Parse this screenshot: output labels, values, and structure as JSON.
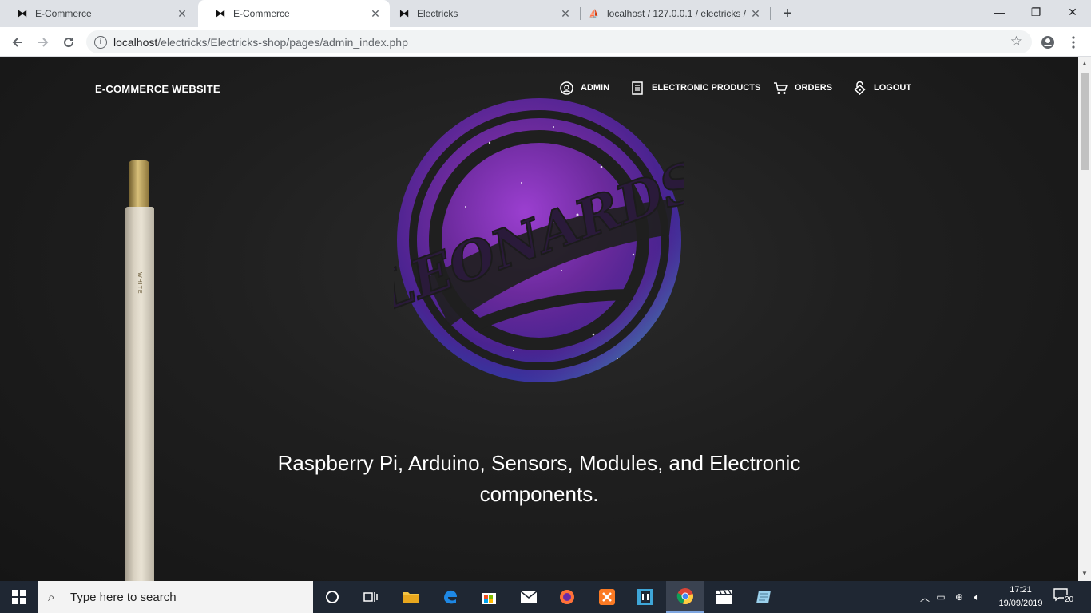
{
  "browser": {
    "tabs": [
      {
        "title": "E-Commerce",
        "active": false
      },
      {
        "title": "E-Commerce",
        "active": true
      },
      {
        "title": "Electricks",
        "active": false
      },
      {
        "title": "localhost / 127.0.0.1 / electricks /",
        "active": false
      }
    ],
    "url_host": "localhost",
    "url_path": "/electricks/Electricks-shop/pages/admin_index.php"
  },
  "site": {
    "brand": "E-COMMERCE WEBSITE",
    "nav": [
      {
        "label": "ADMIN",
        "icon": "user-circle-icon"
      },
      {
        "label": "ELECTRONIC PRODUCTS",
        "icon": "document-icon"
      },
      {
        "label": "ORDERS",
        "icon": "cart-icon"
      },
      {
        "label": "LOGOUT",
        "icon": "lock-icon"
      }
    ],
    "logo_text": "LEONARDS",
    "tagline_line1": "Raspberry Pi, Arduino, Sensors, Modules, and Electronic",
    "tagline_line2": "components.",
    "pencil_text": "WHITE"
  },
  "taskbar": {
    "search_placeholder": "Type here to search",
    "time": "17:21",
    "date": "19/09/2019",
    "notification_count": "20"
  },
  "colors": {
    "page_bg": "#1f1f1f",
    "taskbar_bg": "#1f2733",
    "tabstrip_bg": "#dee1e6",
    "logo_purple": "#6b2a9c",
    "logo_teal": "#3fc6b3"
  }
}
